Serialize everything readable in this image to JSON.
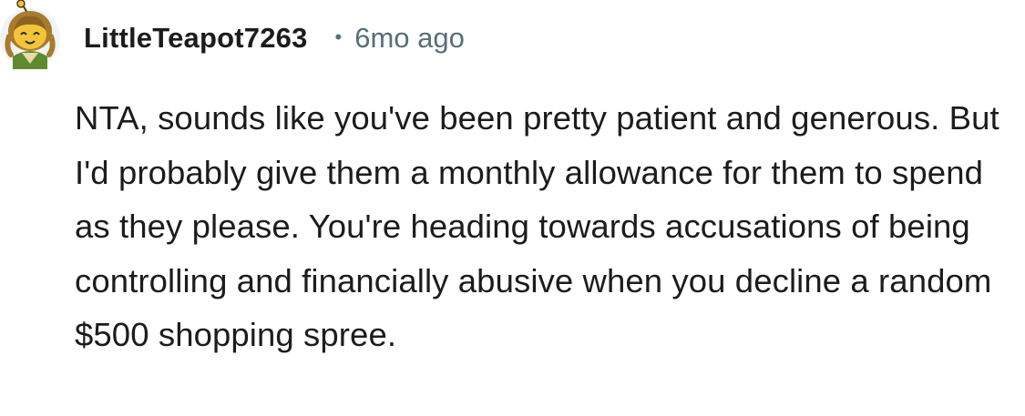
{
  "comment": {
    "author": "LittleTeapot7263",
    "separator": "•",
    "timestamp": "6mo ago",
    "avatar_icon": "snoo-avatar-icon",
    "body": "NTA, sounds like you've been pretty patient and generous. But I'd probably give them a monthly allowance for them to spend as they please. You're heading towards accusations of being controlling and financially abusive when you decline a random $500 shopping spree."
  },
  "colors": {
    "text": "#1c1c1c",
    "meta": "#576f76",
    "background": "#ffffff",
    "avatar_face": "#f3c43a",
    "avatar_hair": "#a87b2e",
    "avatar_body": "#5f8a2f"
  }
}
